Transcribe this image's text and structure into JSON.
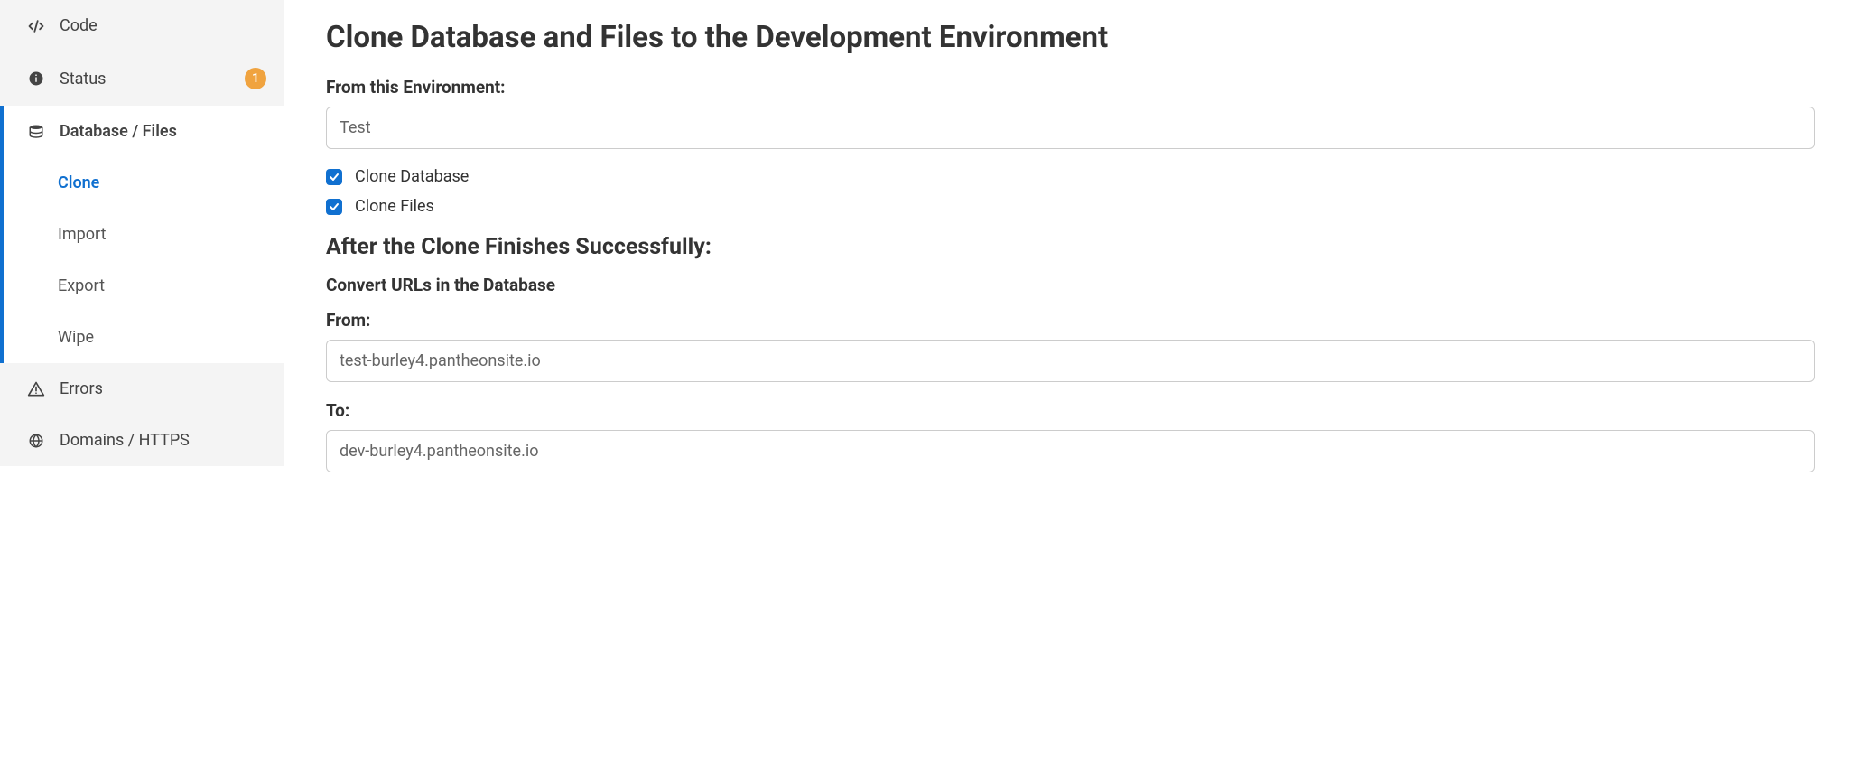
{
  "sidebar": {
    "code": {
      "label": "Code"
    },
    "status": {
      "label": "Status",
      "badge": "1"
    },
    "database_files": {
      "label": "Database / Files"
    },
    "sub": {
      "clone": "Clone",
      "import": "Import",
      "export": "Export",
      "wipe": "Wipe"
    },
    "errors": {
      "label": "Errors"
    },
    "domains": {
      "label": "Domains / HTTPS"
    }
  },
  "main": {
    "heading": "Clone Database and Files to the Development Environment",
    "from_env_label": "From this Environment:",
    "from_env_value": "Test",
    "clone_database_label": "Clone Database",
    "clone_files_label": "Clone Files",
    "after_heading": "After the Clone Finishes Successfully:",
    "convert_label": "Convert URLs in the Database",
    "from_label": "From:",
    "from_value": "test-burley4.pantheonsite.io",
    "to_label": "To:",
    "to_value": "dev-burley4.pantheonsite.io"
  }
}
